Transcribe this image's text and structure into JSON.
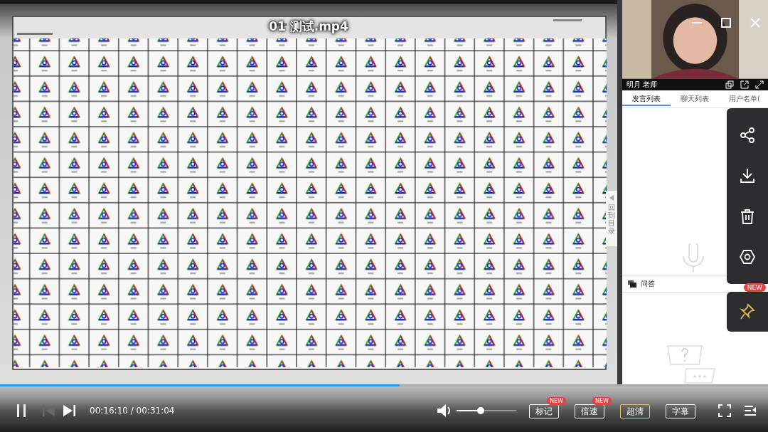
{
  "window": {
    "title": "01 测试.mp4"
  },
  "side_tab": {
    "label": "回到目录"
  },
  "presenter": {
    "name": "明月 老师"
  },
  "tabs": [
    {
      "label": "发言列表",
      "selected": true
    },
    {
      "label": "聊天列表",
      "selected": false
    },
    {
      "label": "用户名单(",
      "selected": false
    }
  ],
  "qa": {
    "label": "问答"
  },
  "toolbar": {
    "pin_badge": "NEW"
  },
  "player": {
    "progress": {
      "level": 0.52
    },
    "previous_disabled": true,
    "time": "00:16:10 / 00:31:04",
    "volume": {
      "level": 0.4
    },
    "buttons": [
      {
        "label": "标记",
        "badge": "NEW",
        "selected": false
      },
      {
        "label": "倍速",
        "badge": "NEW",
        "selected": false
      },
      {
        "label": "超清",
        "selected": true
      },
      {
        "label": "字幕",
        "selected": false
      }
    ]
  }
}
